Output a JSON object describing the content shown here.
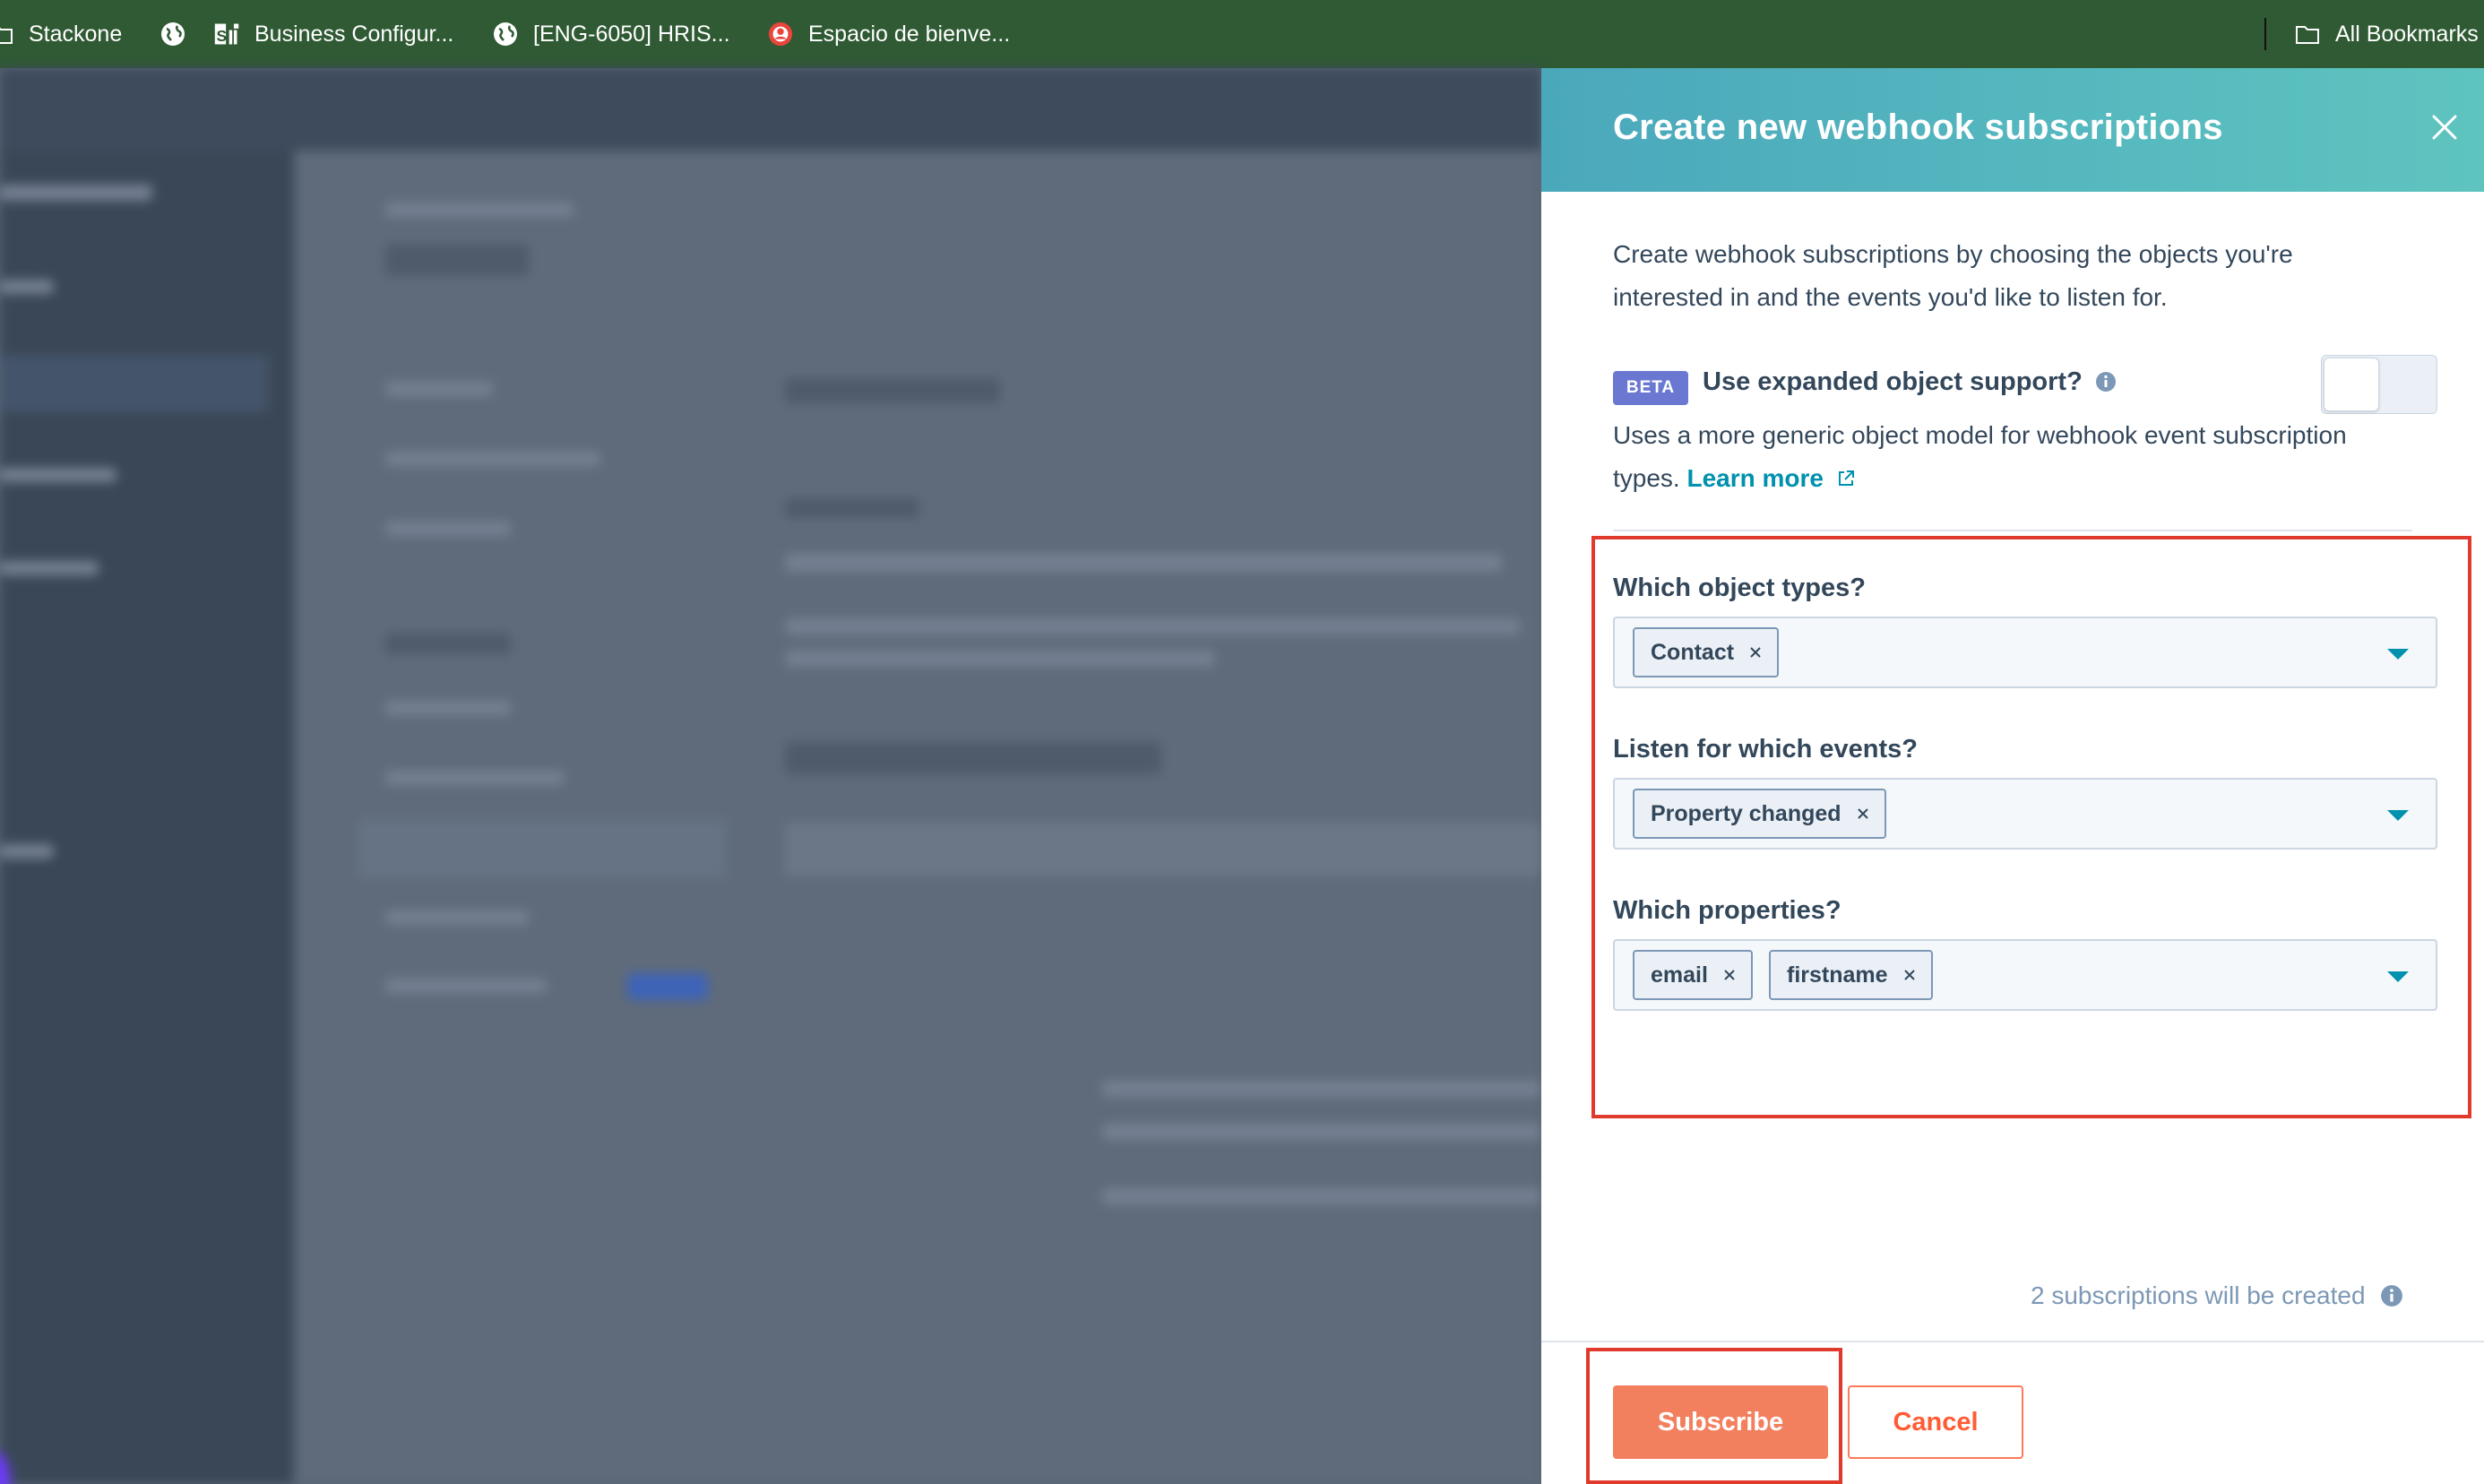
{
  "bookmarks": {
    "items": [
      {
        "label": "Stackone",
        "icon": "folder-icon"
      },
      {
        "label": "Business Configur...",
        "icon": "sfi-logo-icon"
      },
      {
        "label": "[ENG-6050] HRIS...",
        "icon": "globe-icon"
      },
      {
        "label": "Espacio de bienve...",
        "icon": "target-icon"
      }
    ],
    "first_icon": "globe-icon",
    "all_bookmarks": "All Bookmarks"
  },
  "panel": {
    "title": "Create new webhook subscriptions",
    "description": "Create webhook subscriptions by choosing the objects you're interested in and the events you'd like to listen for.",
    "beta_badge": "BETA",
    "expanded_label": "Use expanded object support?",
    "expanded_desc": "Uses a more generic object model for webhook event subscription types.",
    "learn_more": "Learn more",
    "toggle_on": false,
    "object_types": {
      "label": "Which object types?",
      "chips": [
        "Contact"
      ]
    },
    "events": {
      "label": "Listen for which events?",
      "chips": [
        "Property changed"
      ]
    },
    "properties": {
      "label": "Which properties?",
      "chips": [
        "email",
        "firstname"
      ]
    },
    "subscription_count": "2 subscriptions will be created",
    "subscribe_label": "Subscribe",
    "cancel_label": "Cancel"
  },
  "colors": {
    "header_gradient_start": "#4aa8bb",
    "header_gradient_end": "#5fc4bf",
    "primary_button": "#f2805f",
    "link": "#0091ae",
    "highlight": "#e03a2c",
    "bookmark_bar": "#2f5a33"
  }
}
